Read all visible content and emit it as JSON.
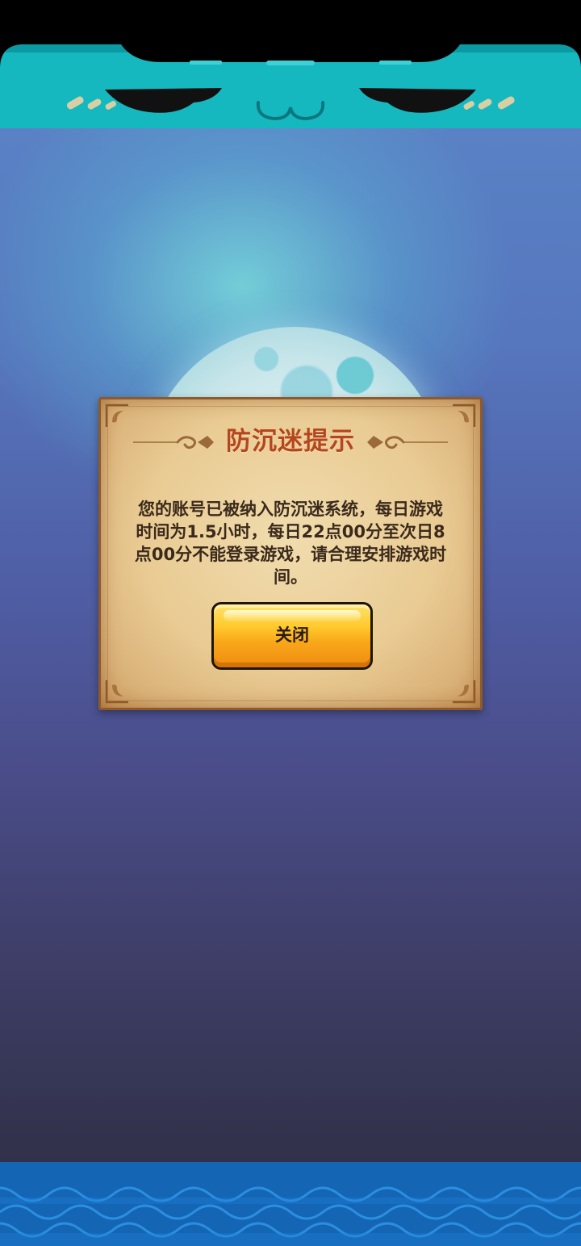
{
  "dialog": {
    "title": "防沉迷提示",
    "message": "您的账号已被纳入防沉迷系统，每日游戏时间为1.5小时，每日22点00分至次日8点00分不能登录游戏，请合理安排游戏时间。",
    "close_label": "关闭"
  },
  "colors": {
    "banner_teal": "#16b8c0",
    "title_red": "#b5461e",
    "button_orange": "#f9a71a",
    "wave_blue": "#1677c9"
  },
  "icons": {
    "top_banner": "cat-face-icon",
    "bottom": "wave-pattern-icon"
  }
}
